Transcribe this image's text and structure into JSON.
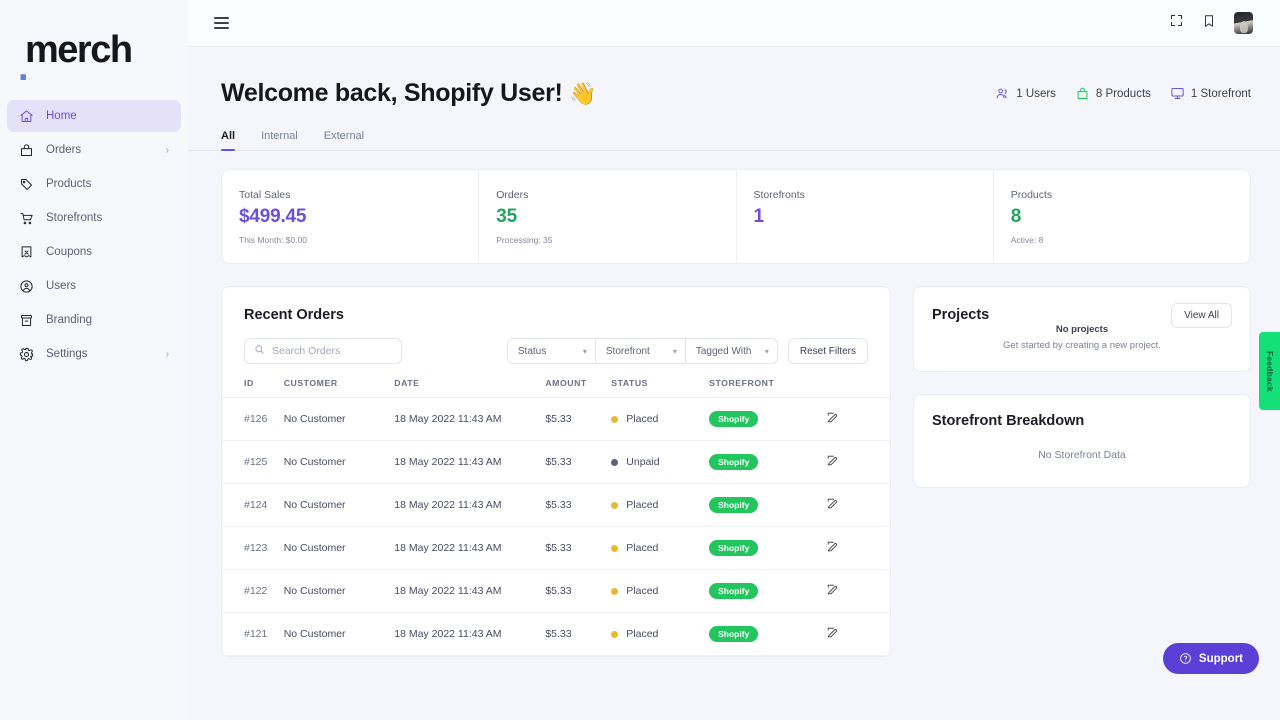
{
  "brand": {
    "dot": ".",
    "name": "merch"
  },
  "sidebar": {
    "items": [
      {
        "label": "Home",
        "icon": "home-icon",
        "active": true,
        "caret": ""
      },
      {
        "label": "Orders",
        "icon": "bag-icon",
        "active": false,
        "caret": "›"
      },
      {
        "label": "Products",
        "icon": "tag-icon",
        "active": false,
        "caret": ""
      },
      {
        "label": "Storefronts",
        "icon": "cart-icon",
        "active": false,
        "caret": ""
      },
      {
        "label": "Coupons",
        "icon": "coupon-icon",
        "active": false,
        "caret": ""
      },
      {
        "label": "Users",
        "icon": "user-circle-icon",
        "active": false,
        "caret": ""
      },
      {
        "label": "Branding",
        "icon": "archive-icon",
        "active": false,
        "caret": ""
      },
      {
        "label": "Settings",
        "icon": "gear-icon",
        "active": false,
        "caret": "›"
      }
    ]
  },
  "topbar": {
    "menu_icon": "hamburger-icon",
    "expand_icon": "fullscreen-icon",
    "bookmark_icon": "bookmark-icon",
    "avatar": "user-avatar"
  },
  "header": {
    "welcome": "Welcome back, Shopify User!",
    "wave": "👋",
    "stats": [
      {
        "icon": "users-icon",
        "label": "1 Users",
        "color": "#6c4ee0"
      },
      {
        "icon": "bag-icon",
        "label": "8 Products",
        "color": "#22c55e"
      },
      {
        "icon": "monitor-icon",
        "label": "1 Storefront",
        "color": "#6c4ee0"
      }
    ]
  },
  "tabs": [
    {
      "label": "All",
      "active": true
    },
    {
      "label": "Internal",
      "active": false
    },
    {
      "label": "External",
      "active": false
    }
  ],
  "stat_cards": [
    {
      "label": "Total Sales",
      "value": "$499.45",
      "sub": "This Month: $0.00",
      "color": "purple"
    },
    {
      "label": "Orders",
      "value": "35",
      "sub": "Processing: 35",
      "color": "green"
    },
    {
      "label": "Storefronts",
      "value": "1",
      "sub": "",
      "color": "purple"
    },
    {
      "label": "Products",
      "value": "8",
      "sub": "Active: 8",
      "color": "green"
    }
  ],
  "orders": {
    "title": "Recent Orders",
    "search": {
      "placeholder": "Search Orders",
      "value": "",
      "icon": "search-icon"
    },
    "filters": [
      {
        "label": "Status",
        "caret": "∨"
      },
      {
        "label": "Storefront",
        "caret": "∨"
      },
      {
        "label": "Tagged With",
        "caret": "∨"
      }
    ],
    "reset_label": "Reset Filters",
    "columns": [
      "ID",
      "CUSTOMER",
      "DATE",
      "AMOUNT",
      "STATUS",
      "STOREFRONT",
      ""
    ],
    "rows": [
      {
        "id": "#126",
        "customer": "No Customer",
        "date": "18 May 2022 11:43 AM",
        "amount": "$5.33",
        "status": "Placed",
        "status_type": "placed",
        "storefront": "Shopify",
        "action": "edit-icon"
      },
      {
        "id": "#125",
        "customer": "No Customer",
        "date": "18 May 2022 11:43 AM",
        "amount": "$5.33",
        "status": "Unpaid",
        "status_type": "unpaid",
        "storefront": "Shopify",
        "action": "edit-icon"
      },
      {
        "id": "#124",
        "customer": "No Customer",
        "date": "18 May 2022 11:43 AM",
        "amount": "$5.33",
        "status": "Placed",
        "status_type": "placed",
        "storefront": "Shopify",
        "action": "edit-icon"
      },
      {
        "id": "#123",
        "customer": "No Customer",
        "date": "18 May 2022 11:43 AM",
        "amount": "$5.33",
        "status": "Placed",
        "status_type": "placed",
        "storefront": "Shopify",
        "action": "edit-icon"
      },
      {
        "id": "#122",
        "customer": "No Customer",
        "date": "18 May 2022 11:43 AM",
        "amount": "$5.33",
        "status": "Placed",
        "status_type": "placed",
        "storefront": "Shopify",
        "action": "edit-icon"
      },
      {
        "id": "#121",
        "customer": "No Customer",
        "date": "18 May 2022 11:43 AM",
        "amount": "$5.33",
        "status": "Placed",
        "status_type": "placed",
        "storefront": "Shopify",
        "action": "edit-icon"
      }
    ]
  },
  "projects": {
    "title": "Projects",
    "view_all": "View All",
    "empty_title": "No projects",
    "empty_sub": "Get started by creating a new project."
  },
  "storefront_breakdown": {
    "title": "Storefront Breakdown",
    "empty": "No Storefront Data"
  },
  "feedback": {
    "label": "Feedback",
    "color": "#14e07a"
  },
  "support": {
    "label": "Support",
    "icon": "question-circle-icon",
    "color": "#5b3fd6"
  }
}
